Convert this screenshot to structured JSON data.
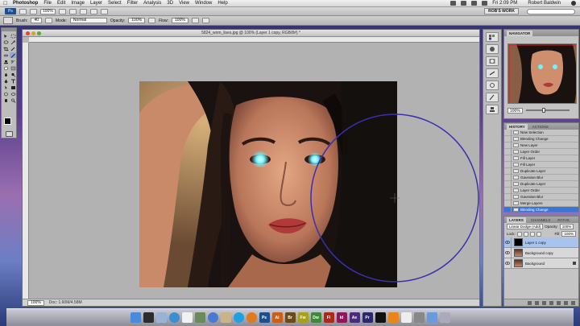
{
  "menubar": {
    "app_name": "Photoshop",
    "menus": [
      "File",
      "Edit",
      "Image",
      "Layer",
      "Select",
      "Filter",
      "Analysis",
      "3D",
      "View",
      "Window",
      "Help"
    ],
    "clock": "Fri 2:09 PM",
    "user": "Robert Baldwin"
  },
  "appbar": {
    "logo": "Ps",
    "zoom_value": "100%",
    "workspace": "ROB'S WORK"
  },
  "optbar": {
    "brush_label": "Brush:",
    "brush_size": "40",
    "mode_label": "Mode:",
    "mode_value": "Normal",
    "opacity_label": "Opacity:",
    "opacity_value": "100%",
    "flow_label": "Flow:",
    "flow_value": "100%"
  },
  "document": {
    "title": "5824_wom_lises.jpg @ 100% (Layer 1 copy, RGB/8#) *",
    "zoom": "100%",
    "doc_info": "Doc: 1.60M/4.58M"
  },
  "navigator": {
    "tab": "NAVIGATOR",
    "zoom": "100%"
  },
  "history": {
    "tabs": [
      "HISTORY",
      "ACTIONS"
    ],
    "items": [
      "New Selection",
      "Blending Change",
      "New Layer",
      "Layer Order",
      "Fill Layer",
      "Fill Layer",
      "Duplicate Layer",
      "Gaussian Blur",
      "Duplicate Layer",
      "Layer Order",
      "Gaussian Blur",
      "Merge Layers",
      "Blending Change"
    ],
    "active_index": 12
  },
  "layers": {
    "tabs": [
      "LAYERS",
      "CHANNELS",
      "PATHS"
    ],
    "blend_mode": "Linear Dodge (Add)",
    "opacity_label": "Opacity:",
    "opacity": "100%",
    "lock_label": "Lock:",
    "fill_label": "Fill:",
    "fill": "100%",
    "items": [
      {
        "name": "Layer 1 copy",
        "active": true
      },
      {
        "name": "Background copy",
        "active": false
      },
      {
        "name": "Background",
        "active": false
      }
    ]
  },
  "colors": {
    "foreground": "#000000",
    "background": "#ffffff",
    "brush_circle": "#3a2fb0",
    "eye_glow": "#6ff2ff",
    "selection_highlight": "#3875d7"
  },
  "dock": {
    "icons": [
      "finder-icon",
      "dashboard-icon",
      "mail-icon",
      "safari-icon",
      "ical-icon",
      "iphoto-icon",
      "itunes-icon",
      "preview-icon",
      "skype-icon",
      "firefox-icon",
      "ps-icon",
      "ai-icon",
      "br-icon",
      "fw-icon",
      "dw-icon",
      "fl-icon",
      "id-icon",
      "ae-icon",
      "pr-icon",
      "terminal-icon",
      "vlc-icon",
      "textedit-icon",
      "prefs-icon",
      "folder-icon",
      "trash-icon"
    ],
    "labels": [
      "Ps",
      "Ai",
      "Br",
      "Fw",
      "Dw",
      "Fl",
      "Id",
      "Ae",
      "Pr"
    ]
  }
}
